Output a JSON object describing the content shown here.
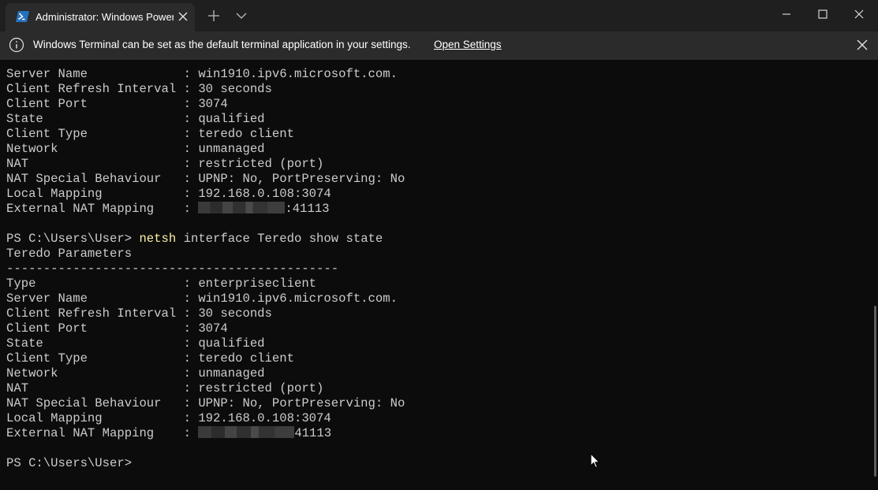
{
  "tab": {
    "title": "Administrator: Windows PowerShell"
  },
  "infobar": {
    "message": "Windows Terminal can be set as the default terminal application in your settings.",
    "link": "Open Settings"
  },
  "terminal": {
    "lines": [
      {
        "label": "Server Name            ",
        "value": "win1910.ipv6.microsoft.com."
      },
      {
        "label": "Client Refresh Interval",
        "value": "30 seconds"
      },
      {
        "label": "Client Port            ",
        "value": "3074"
      },
      {
        "label": "State                  ",
        "value": "qualified"
      },
      {
        "label": "Client Type            ",
        "value": "teredo client"
      },
      {
        "label": "Network                ",
        "value": "unmanaged"
      },
      {
        "label": "NAT                    ",
        "value": "restricted (port)"
      },
      {
        "label": "NAT Special Behaviour  ",
        "value": "UPNP: No, PortPreserving: No"
      },
      {
        "label": "Local Mapping          ",
        "value": "192.168.0.108:3074"
      },
      {
        "label": "External NAT Mapping   ",
        "value": ":41113",
        "redacted": true
      },
      {
        "blank": true
      },
      {
        "prompt": "PS C:\\Users\\User> ",
        "command": "netsh",
        "args": " interface Teredo show state"
      },
      {
        "text": "Teredo Parameters"
      },
      {
        "text": "---------------------------------------------"
      },
      {
        "label": "Type                   ",
        "value": "enterpriseclient"
      },
      {
        "label": "Server Name            ",
        "value": "win1910.ipv6.microsoft.com."
      },
      {
        "label": "Client Refresh Interval",
        "value": "30 seconds"
      },
      {
        "label": "Client Port            ",
        "value": "3074"
      },
      {
        "label": "State                  ",
        "value": "qualified"
      },
      {
        "label": "Client Type            ",
        "value": "teredo client"
      },
      {
        "label": "Network                ",
        "value": "unmanaged"
      },
      {
        "label": "NAT                    ",
        "value": "restricted (port)"
      },
      {
        "label": "NAT Special Behaviour  ",
        "value": "UPNP: No, PortPreserving: No"
      },
      {
        "label": "Local Mapping          ",
        "value": "192.168.0.108:3074"
      },
      {
        "label": "External NAT Mapping   ",
        "value": "41113",
        "redacted": true
      },
      {
        "blank": true
      },
      {
        "prompt": "PS C:\\Users\\User> ",
        "command": "",
        "args": ""
      }
    ]
  },
  "icons": [
    "powershell-icon",
    "close-icon",
    "plus-icon",
    "chevron-down-icon",
    "minimize-icon",
    "maximize-icon",
    "info-icon",
    "mouse-pointer-icon"
  ],
  "colors": {
    "background": "#0c0c0c",
    "text": "#cccccc",
    "command": "#f9f1a5",
    "titlebar": "#1f1f1f",
    "infobar": "#2b2b2b"
  }
}
